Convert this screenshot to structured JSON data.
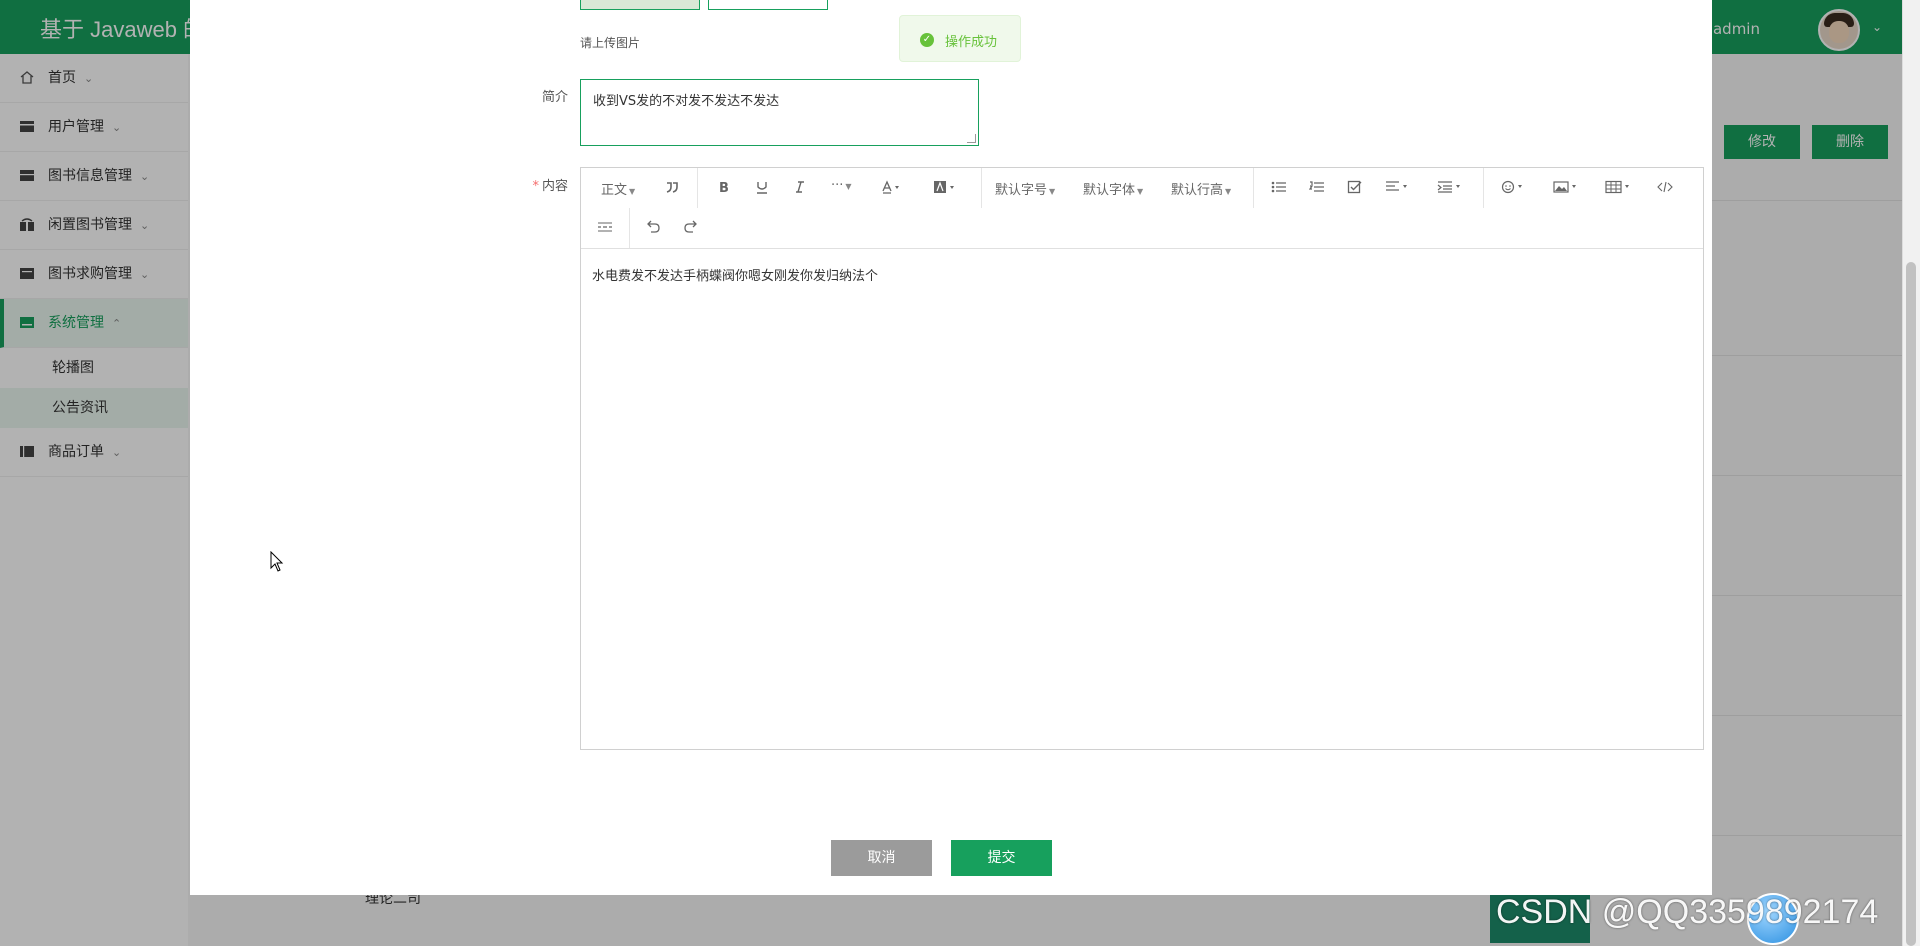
{
  "app": {
    "title": "基于 Javaweb 的",
    "welcome": "欢迎 admin",
    "user_caret": "⌄"
  },
  "sidebar": {
    "items": [
      {
        "label": "首页",
        "icon": "home-icon"
      },
      {
        "label": "用户管理",
        "icon": "user-icon"
      },
      {
        "label": "图书信息管理",
        "icon": "book-icon"
      },
      {
        "label": "闲置图书管理",
        "icon": "gift-icon"
      },
      {
        "label": "图书求购管理",
        "icon": "cart-icon"
      },
      {
        "label": "系统管理",
        "icon": "settings-icon",
        "active": true
      },
      {
        "label": "商品订单",
        "icon": "order-icon"
      }
    ],
    "submenu": [
      {
        "label": "轮播图"
      },
      {
        "label": "公告资讯",
        "active": true
      }
    ],
    "caret": "⌄",
    "caret_up": "⌃"
  },
  "background": {
    "modify_button": "修改",
    "delete_button": "删除",
    "row_text": "理论二司"
  },
  "modal": {
    "upload_hint": "请上传图片",
    "intro_label": "简介",
    "intro_value": "收到VS发的不对发不发达不发达",
    "content_label": "内容",
    "content_required": "*",
    "editor": {
      "toolbar": {
        "paragraph": "正文",
        "font_size": "默认字号",
        "font_family": "默认字体",
        "line_height": "默认行高",
        "more": "···"
      },
      "content": "水电费发不发达手柄蝶阀你嗯女刚发你发归纳法个"
    },
    "cancel_button": "取消",
    "submit_button": "提交"
  },
  "toast": {
    "message": "操作成功",
    "status": "success",
    "color": "#67c23a"
  },
  "watermark": "CSDN @QQ3359892174",
  "colors": {
    "primary": "#17a05d",
    "cancel": "#9b9b9b",
    "success": "#67c23a"
  }
}
